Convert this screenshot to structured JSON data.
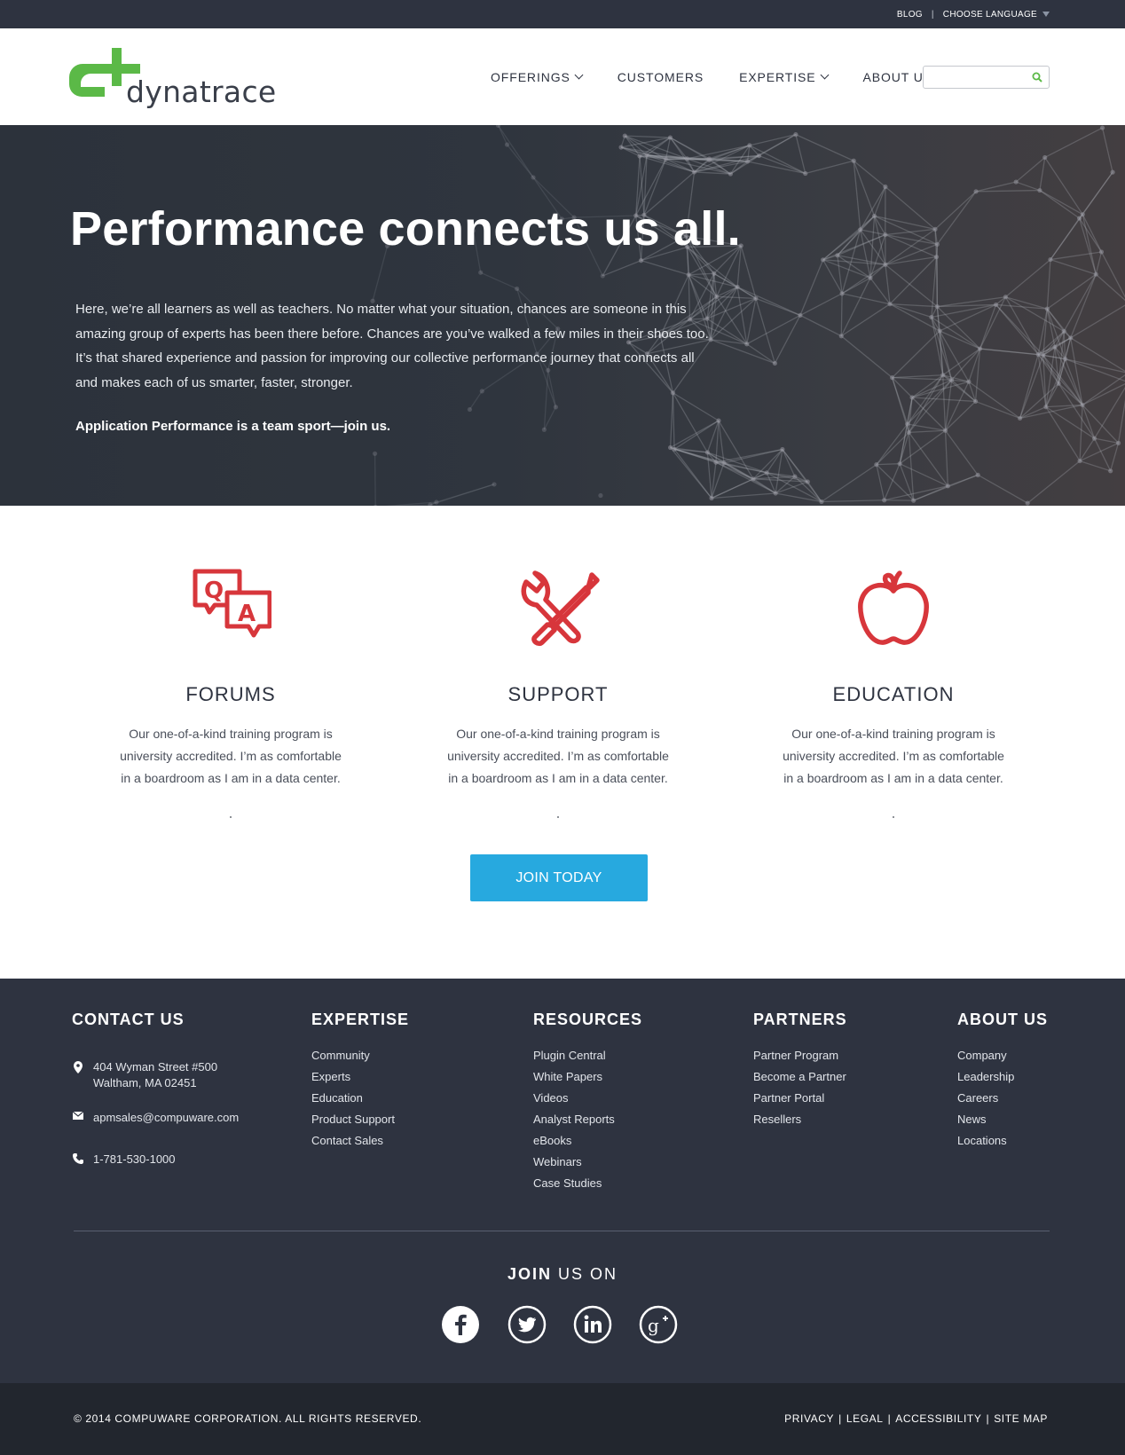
{
  "topbar": {
    "blog": "BLOG",
    "separator": "|",
    "language": "CHOOSE LANGUAGE"
  },
  "header": {
    "logo_text": "dynatrace",
    "nav": [
      {
        "label": "OFFERINGS",
        "has_dropdown": true
      },
      {
        "label": "CUSTOMERS",
        "has_dropdown": false
      },
      {
        "label": "EXPERTISE",
        "has_dropdown": true
      },
      {
        "label": "ABOUT US",
        "has_dropdown": true
      }
    ],
    "search_placeholder": ""
  },
  "hero": {
    "title": "Performance connects us all.",
    "body": "Here, we’re all learners as well as teachers. No matter what your situation, chances are someone in this amazing group of experts has been there before. Chances are you’ve walked a few miles in their shoes too. It’s that shared experience and passion for improving our collective performance journey that connects all and makes each of us smarter, faster, stronger.",
    "tagline": "Application Performance is a team sport—join us."
  },
  "features": [
    {
      "title": "FORUMS",
      "icon": "qa-bubbles-icon",
      "text": "Our one-of-a-kind training program is university accredited. I’m as comfortable in a boardroom as I am in a data center."
    },
    {
      "title": "SUPPORT",
      "icon": "wrench-screwdriver-icon",
      "text": "Our one-of-a-kind training program is university accredited. I’m as comfortable in a boardroom as I am in a data center."
    },
    {
      "title": "EDUCATION",
      "icon": "apple-icon",
      "text": "Our one-of-a-kind training program is university accredited. I’m as comfortable in a boardroom as I am in a data center."
    }
  ],
  "join_button": "JOIN TODAY",
  "footer": {
    "contact": {
      "title": "CONTACT US",
      "address_line1": "404 Wyman Street #500",
      "address_line2": "Waltham, MA 02451",
      "email": "apmsales@compuware.com",
      "phone": "1-781-530-1000"
    },
    "expertise": {
      "title": "EXPERTISE",
      "links": [
        "Community",
        "Experts",
        "Education",
        "Product Support",
        "Contact Sales"
      ]
    },
    "resources": {
      "title": "RESOURCES",
      "links": [
        "Plugin Central",
        "White Papers",
        "Videos",
        "Analyst Reports",
        "eBooks",
        "Webinars",
        "Case Studies"
      ]
    },
    "partners": {
      "title": "PARTNERS",
      "links": [
        "Partner Program",
        "Become a Partner",
        "Partner Portal",
        "Resellers"
      ]
    },
    "about": {
      "title": "ABOUT US",
      "links": [
        "Company",
        "Leadership",
        "Careers",
        "News",
        "Locations"
      ]
    },
    "join_bold": "JOIN",
    "join_rest": " US ON",
    "social": [
      "facebook-icon",
      "twitter-icon",
      "linkedin-icon",
      "google-plus-icon"
    ]
  },
  "bottom": {
    "copyright": "© 2014 COMPUWARE CORPORATION. ALL RIGHTS RESERVED.",
    "links": [
      "PRIVACY",
      "LEGAL",
      "ACCESSIBILITY",
      "SITE MAP"
    ],
    "separator": "|"
  },
  "colors": {
    "dark": "#2e3340",
    "accent_green": "#5bb947",
    "icon_red": "#d7363b",
    "button_blue": "#27a9df"
  }
}
